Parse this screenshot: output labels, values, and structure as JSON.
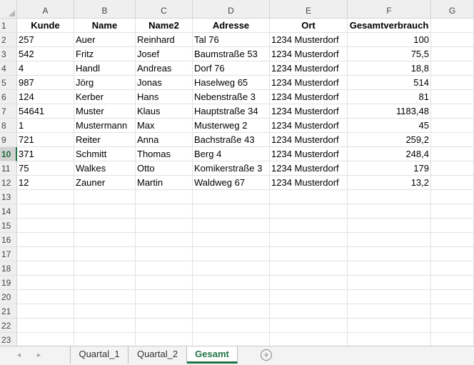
{
  "columns": [
    "A",
    "B",
    "C",
    "D",
    "E",
    "F",
    "G"
  ],
  "row_numbers": [
    "1",
    "2",
    "3",
    "4",
    "5",
    "6",
    "7",
    "8",
    "9",
    "10",
    "11",
    "12",
    "13",
    "14",
    "15",
    "16",
    "17",
    "18",
    "19",
    "20",
    "21",
    "22",
    "23"
  ],
  "selected_row": "10",
  "header_row": [
    "Kunde",
    "Name",
    "Name2",
    "Adresse",
    "Ort",
    "Gesamtverbrauch"
  ],
  "rows": [
    [
      "257",
      "Auer",
      "Reinhard",
      "Tal 76",
      "1234 Musterdorf",
      "100"
    ],
    [
      "542",
      "Fritz",
      "Josef",
      "Baumstraße 53",
      "1234 Musterdorf",
      "75,5"
    ],
    [
      "4",
      "Handl",
      "Andreas",
      "Dorf 76",
      "1234 Musterdorf",
      "18,8"
    ],
    [
      "987",
      "Jörg",
      "Jonas",
      "Haselweg 65",
      "1234 Musterdorf",
      "514"
    ],
    [
      "124",
      "Kerber",
      "Hans",
      "Nebenstraße 3",
      "1234 Musterdorf",
      "81"
    ],
    [
      "54641",
      "Muster",
      "Klaus",
      "Hauptstraße 34",
      "1234 Musterdorf",
      "1183,48"
    ],
    [
      "1",
      "Mustermann",
      "Max",
      "Musterweg 2",
      "1234 Musterdorf",
      "45"
    ],
    [
      "721",
      "Reiter",
      "Anna",
      "Bachstraße 43",
      "1234 Musterdorf",
      "259,2"
    ],
    [
      "371",
      "Schmitt",
      "Thomas",
      "Berg 4",
      "1234 Musterdorf",
      "248,4"
    ],
    [
      "75",
      "Walkes",
      "Otto",
      "Komikerstraße 3",
      "1234 Musterdorf",
      "179"
    ],
    [
      "12",
      "Zauner",
      "Martin",
      "Waldweg 67",
      "1234 Musterdorf",
      "13,2"
    ]
  ],
  "tabs": [
    {
      "label": "Quartal_1",
      "active": false
    },
    {
      "label": "Quartal_2",
      "active": false
    },
    {
      "label": "Gesamt",
      "active": true
    }
  ],
  "nav": {
    "prev": "◂",
    "next": "▸",
    "add": "+"
  },
  "colors": {
    "accent": "#217346",
    "header_bg": "#efefef",
    "gridline": "#e1e1e1"
  }
}
